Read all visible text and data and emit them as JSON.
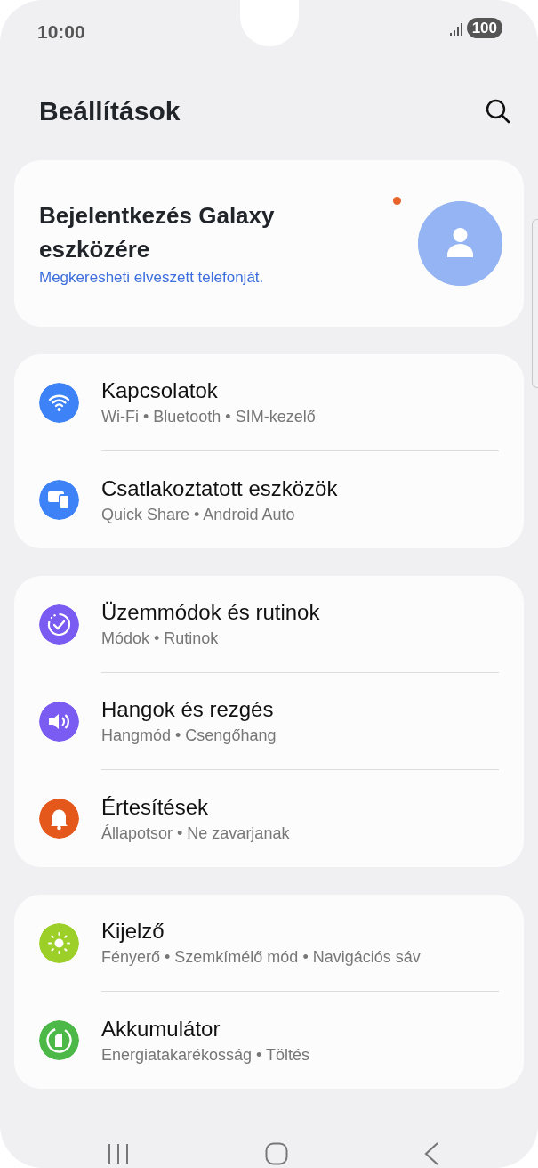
{
  "status_bar": {
    "time": "10:00",
    "battery": "100"
  },
  "header": {
    "title": "Beállítások"
  },
  "account": {
    "title": "Bejelentkezés Galaxy eszközére",
    "subtitle": "Megkeresheti elveszett telefonját.",
    "notification_dot": true
  },
  "groups": [
    {
      "items": [
        {
          "kind": "wifi",
          "color": "#3e82f7",
          "title": "Kapcsolatok",
          "subtitle": "Wi-Fi • Bluetooth • SIM-kezelő"
        },
        {
          "kind": "devices",
          "color": "#3e82f7",
          "title": "Csatlakoztatott eszközök",
          "subtitle": "Quick Share • Android Auto"
        }
      ]
    },
    {
      "items": [
        {
          "kind": "modes",
          "color": "#7a5cf2",
          "title": "Üzemmódok és rutinok",
          "subtitle": "Módok • Rutinok"
        },
        {
          "kind": "sound",
          "color": "#7a5cf2",
          "title": "Hangok és rezgés",
          "subtitle": "Hangmód • Csengőhang"
        },
        {
          "kind": "bell",
          "color": "#e5581c",
          "title": "Értesítések",
          "subtitle": "Állapotsor • Ne zavarjanak"
        }
      ]
    },
    {
      "items": [
        {
          "kind": "sun",
          "color": "#9ccf27",
          "title": "Kijelző",
          "subtitle": "Fényerő • Szemkímélő mód • Navigációs sáv"
        },
        {
          "kind": "battery",
          "color": "#4cb847",
          "title": "Akkumulátor",
          "subtitle": "Energiatakarékosság • Töltés"
        }
      ]
    }
  ]
}
